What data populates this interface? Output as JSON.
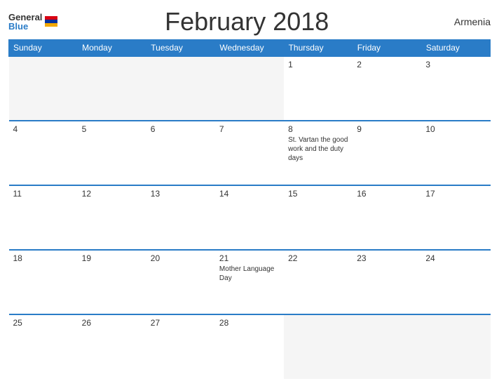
{
  "header": {
    "logo_general": "General",
    "logo_blue": "Blue",
    "title": "February 2018",
    "country": "Armenia"
  },
  "weekdays": [
    "Sunday",
    "Monday",
    "Tuesday",
    "Wednesday",
    "Thursday",
    "Friday",
    "Saturday"
  ],
  "weeks": [
    [
      {
        "day": "",
        "empty": true
      },
      {
        "day": "",
        "empty": true
      },
      {
        "day": "",
        "empty": true
      },
      {
        "day": "",
        "empty": true
      },
      {
        "day": "1",
        "event": ""
      },
      {
        "day": "2",
        "event": ""
      },
      {
        "day": "3",
        "event": ""
      }
    ],
    [
      {
        "day": "4",
        "event": ""
      },
      {
        "day": "5",
        "event": ""
      },
      {
        "day": "6",
        "event": ""
      },
      {
        "day": "7",
        "event": ""
      },
      {
        "day": "8",
        "event": "St. Vartan the good work and the duty days"
      },
      {
        "day": "9",
        "event": ""
      },
      {
        "day": "10",
        "event": ""
      }
    ],
    [
      {
        "day": "11",
        "event": ""
      },
      {
        "day": "12",
        "event": ""
      },
      {
        "day": "13",
        "event": ""
      },
      {
        "day": "14",
        "event": ""
      },
      {
        "day": "15",
        "event": ""
      },
      {
        "day": "16",
        "event": ""
      },
      {
        "day": "17",
        "event": ""
      }
    ],
    [
      {
        "day": "18",
        "event": ""
      },
      {
        "day": "19",
        "event": ""
      },
      {
        "day": "20",
        "event": ""
      },
      {
        "day": "21",
        "event": "Mother Language Day"
      },
      {
        "day": "22",
        "event": ""
      },
      {
        "day": "23",
        "event": ""
      },
      {
        "day": "24",
        "event": ""
      }
    ],
    [
      {
        "day": "25",
        "event": ""
      },
      {
        "day": "26",
        "event": ""
      },
      {
        "day": "27",
        "event": ""
      },
      {
        "day": "28",
        "event": ""
      },
      {
        "day": "",
        "empty": true
      },
      {
        "day": "",
        "empty": true
      },
      {
        "day": "",
        "empty": true
      }
    ]
  ]
}
